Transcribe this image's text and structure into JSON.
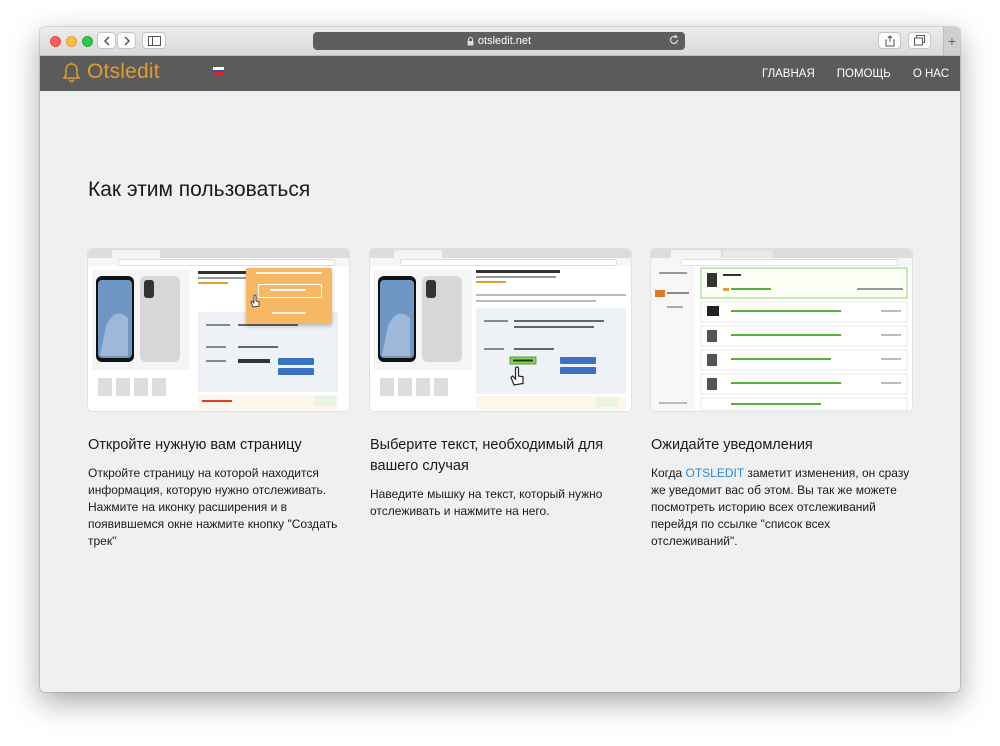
{
  "browser": {
    "url": "otsledit.net",
    "new_tab_symbol": "+"
  },
  "site": {
    "brand": "Otsledit",
    "nav": [
      "ГЛАВНАЯ",
      "ПОМОЩЬ",
      "О НАС"
    ],
    "colors": {
      "brand": "#e09d2c",
      "navbar": "#5b5b5b",
      "link": "#2a8ad4"
    }
  },
  "section": {
    "title": "Как этим пользоваться"
  },
  "steps": [
    {
      "title": "Откройте нужную вам страницу",
      "text": "Откройте страницу на которой находится информация, которую нужно отслеживать. Нажмите на иконку расширения и в появившемся окне нажмите кнопку \"Создать трек\""
    },
    {
      "title": "Выберите текст, необходимый для вашего случая",
      "text": "Наведите мышку на текст, который нужно отслеживать и нажмите на него."
    },
    {
      "title": "Ожидайте уведомления",
      "text_before": "Когда ",
      "text_highlight": "OTSLEDIT",
      "text_after": " заметит изменения, он сразу же уведомит вас об этом. Вы так же можете посмотреть историю всех отслеживаний перейдя по ссылке \"список всех отслеживаний\"."
    }
  ],
  "screenshots": {
    "s1": {
      "product": "Apple iPhone X 64GB Silver",
      "price": "US $575.95",
      "buy": "Buy It Now",
      "cart": "Add to cart",
      "popup_title": "Know about the changes",
      "popup_btn": "CREATE TRACK",
      "popup_link": "List of all tracks"
    },
    "s2": {
      "product": "Apple iPhone X 64GB Silver Unlocked",
      "price": "US $575.95",
      "buy": "Buy It Now",
      "cart": "Add to cart"
    },
    "s3": {
      "app": "OTSLEDIT.NET",
      "menu1": "Watchlist",
      "menu2": "History",
      "price1": "575.95",
      "item": "ANDROID"
    }
  }
}
